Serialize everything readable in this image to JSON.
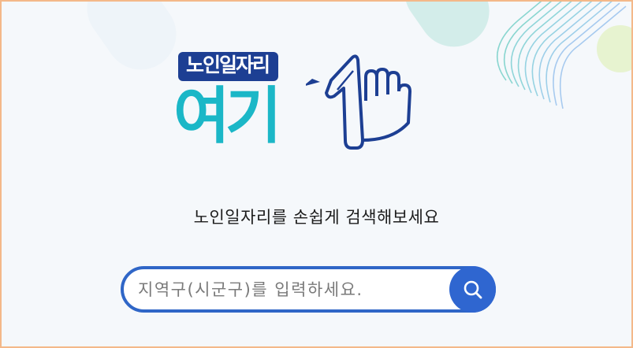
{
  "logo": {
    "badge_text": "노인일자리",
    "main_text": "여기"
  },
  "headline": "노인일자리를 손쉽게 검색해보세요",
  "search": {
    "placeholder": "지역구(시군구)를 입력하세요.",
    "value": "",
    "button_icon": "search-icon"
  },
  "colors": {
    "accent_blue": "#2f66d0",
    "logo_navy": "#1d3f93",
    "logo_teal": "#1bb7c7",
    "frame_border": "#f4b889",
    "background": "#f5f8fb"
  }
}
